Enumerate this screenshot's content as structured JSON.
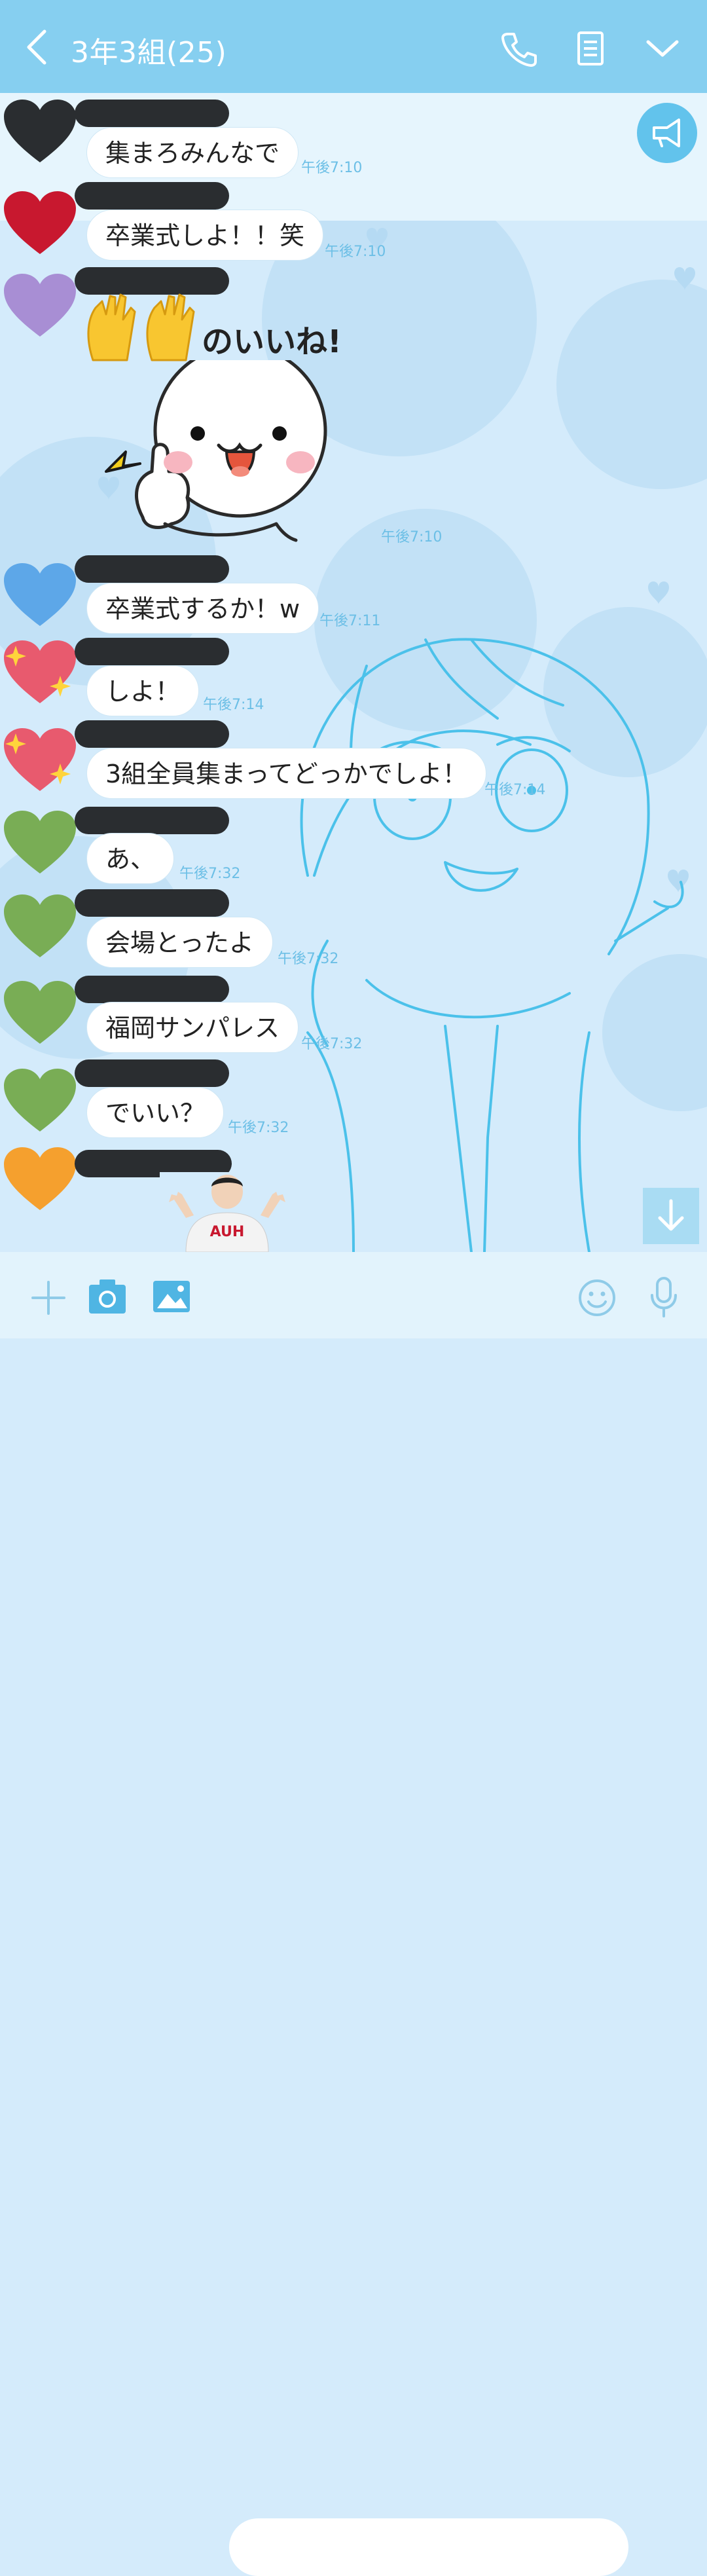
{
  "header": {
    "title": "3年3組(25)",
    "bg_color": "#86cff0"
  },
  "messages": [
    {
      "text": "集まろみんなで",
      "time": "午後7:10",
      "avatar_color": "#2a2d30"
    },
    {
      "text": "卒業式しよ！！笑",
      "time": "午後7:10",
      "avatar_color": "#c8182f"
    },
    {
      "sticker_text": "のいいね!",
      "time": "午後7:10",
      "avatar_color": "#a88ed4"
    },
    {
      "text": "卒業式するか！w",
      "time": "午後7:11",
      "avatar_color": "#5da7e8"
    },
    {
      "text": "しよ！",
      "time": "午後7:14",
      "avatar_color": "#e85a6e"
    },
    {
      "text": "3組全員集まってどっかでしよ！",
      "time": "午後7:14",
      "avatar_color": "#e85a6e"
    },
    {
      "text": "あ、",
      "time": "午後7:32",
      "avatar_color": "#79ad55"
    },
    {
      "text": "会場とったよ",
      "time": "午後7:32",
      "avatar_color": "#79ad55"
    },
    {
      "text": "福岡サンパレス",
      "time": "午後7:32",
      "avatar_color": "#79ad55"
    },
    {
      "text": "でいい？",
      "time": "午後7:32",
      "avatar_color": "#79ad55"
    },
    {
      "photo": "person-thumbs-up",
      "avatar_color": "#f5a02e"
    }
  ],
  "photo_shirt_text": "AUH",
  "footer": {
    "input_placeholder": ""
  },
  "icons": {
    "back": "chevron-left-icon",
    "call": "phone-icon",
    "notes": "notes-icon",
    "menu": "chevron-down-icon",
    "announce": "megaphone-icon",
    "plus": "plus-icon",
    "camera": "camera-icon",
    "image": "image-icon",
    "emoji": "emoji-icon",
    "mic": "mic-icon",
    "scroll": "arrow-down-icon"
  }
}
